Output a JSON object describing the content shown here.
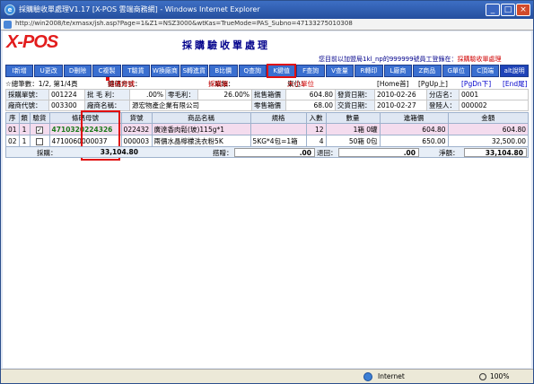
{
  "window": {
    "title": "採購驗收單處理V1.17 [X-POS 雲端商務網] - Windows Internet Explorer",
    "address": "http://win2008/te/xmasx/jsh.asp?Page=1&Z1=NSZ3000&wtKas=TrueMode=PAS_Subno=47133275010308"
  },
  "app": {
    "logo": "X-POS",
    "page_title": "採購驗收單處理",
    "notice_prefix": "您目前以加盟局1kl_np的999999號員工登錄在：",
    "notice_module": "採購驗收單處理"
  },
  "toolbar": [
    {
      "label": "I新增",
      "highlight": false
    },
    {
      "label": "U更改",
      "highlight": false
    },
    {
      "label": "D刪除",
      "highlight": false
    },
    {
      "label": "C複製",
      "highlight": false
    },
    {
      "label": "T驗貨",
      "highlight": false
    },
    {
      "label": "W換廠商",
      "highlight": false
    },
    {
      "label": "S轉進貨",
      "highlight": false
    },
    {
      "label": "B比價",
      "highlight": false
    },
    {
      "label": "Q查詢",
      "highlight": false
    },
    {
      "label": "K鍵值",
      "highlight": true
    },
    {
      "label": "F查詢",
      "highlight": false
    },
    {
      "label": "V查量",
      "highlight": false
    },
    {
      "label": "R轉印",
      "highlight": false
    },
    {
      "label": "L廠商",
      "highlight": false
    },
    {
      "label": "Z商品",
      "highlight": false
    },
    {
      "label": "G單位",
      "highlight": false
    },
    {
      "label": "C頂端",
      "highlight": false
    },
    {
      "label": "alt說明",
      "highlight": false
    }
  ],
  "info": {
    "total_pages_label": "☆總筆數：1/2, 第1/4頁",
    "key_mode_label": "鍵值方式：",
    "key_mode_value": "條碼母號",
    "unit_mode_label": "☆單類：",
    "unit_mode_value": "採購單",
    "unit_label": "單位：",
    "unit_value": "大小單位",
    "nav_home": "[Home首]",
    "nav_pgup": "[PgUp上]",
    "nav_pgdn": "[PgDn下]",
    "nav_end": "[End尾]"
  },
  "header": {
    "row1": {
      "k1": "採購單號：",
      "v1": "001224",
      "k2": "批 毛 利：",
      "v2": ".00%",
      "k3": "零毛利：",
      "v3": "26.00%",
      "k4": "批售箱價",
      "v4": "604.80",
      "k5": "發貨日期：",
      "v5": "2010-02-26",
      "k6": "分店名：",
      "v6": "0001"
    },
    "row2": {
      "k1": "廠商代號：",
      "v1": "003300",
      "k2": "廠商名稱：",
      "v2": "源宏物產企業有限公司",
      "k4": "零售箱價",
      "v4": "68.00",
      "k5": "交貨日期：",
      "v5": "2010-02-27",
      "k6": "登陸人：",
      "v6": "000002"
    }
  },
  "grid": {
    "columns": [
      "序",
      "類",
      "驗貨",
      "條碼母號",
      "貨號",
      "商品名稱",
      "規格",
      "入數",
      "數量",
      "進箱價",
      "金額"
    ],
    "rows": [
      {
        "seq": "01",
        "type": "1",
        "checked": "✓",
        "barcode": "4710320224326",
        "sku": "022432",
        "name": "廣達香肉鬆(玻)115g*1",
        "spec": "",
        "pack": "12",
        "qty": "1箱  0罐",
        "price": "604.80",
        "amount": "604.80"
      },
      {
        "seq": "02",
        "type": "1",
        "checked": "",
        "barcode": "4710060000037",
        "sku": "000003",
        "name": "兩價水晶檸檬洗衣粉5K",
        "spec": "5KG*4包=1箱",
        "pack": "4",
        "qty": "50箱  0包",
        "price": "650.00",
        "amount": "32,500.00"
      }
    ]
  },
  "totals": {
    "purchase_label": "採購：",
    "purchase_value": "33,104.80",
    "discount_label": "搭贈：",
    "discount_value": ".00",
    "return_label": "退回：",
    "return_value": ".00",
    "net_label": "淨額：",
    "net_value": "33,104.80"
  },
  "statusbar": {
    "zone": "Internet",
    "zoom": "100%"
  }
}
